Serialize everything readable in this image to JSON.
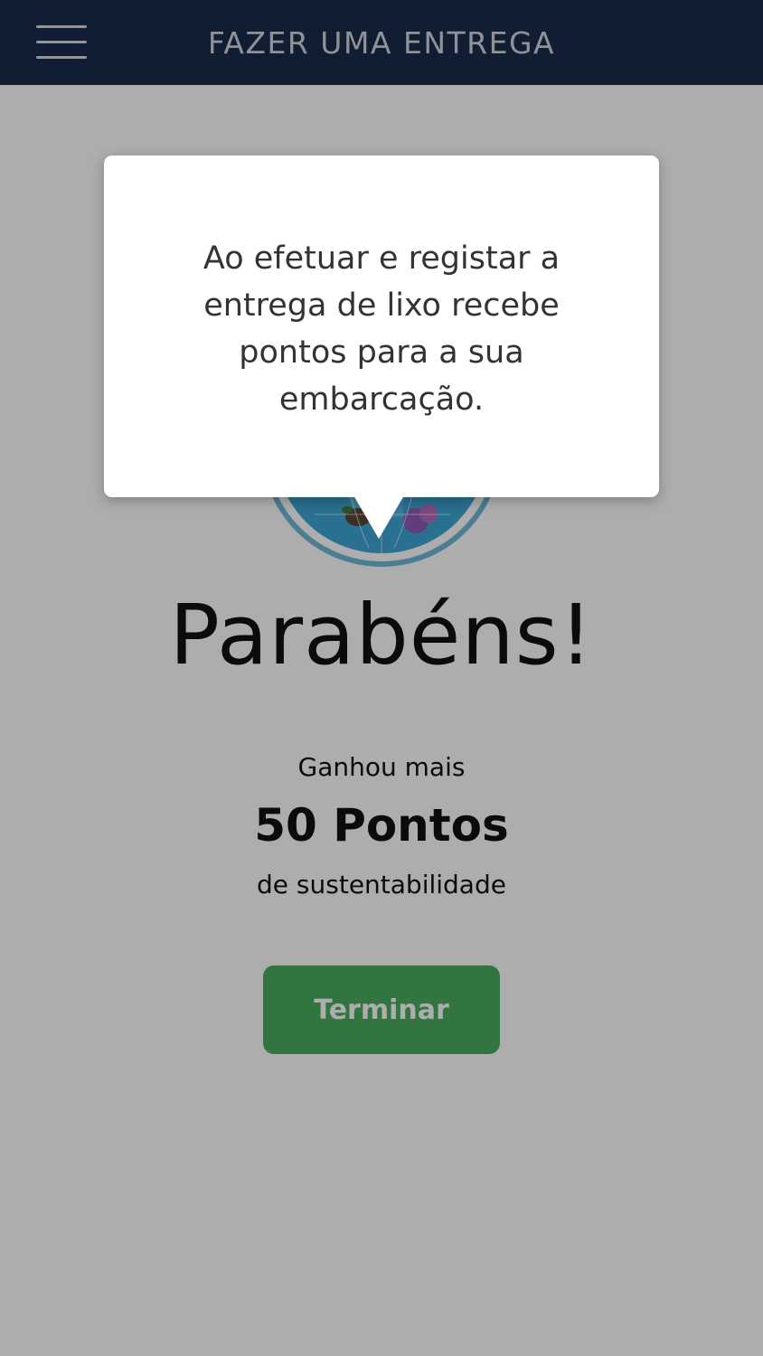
{
  "header": {
    "title": "FAZER UMA ENTREGA",
    "menu_icon": "hamburger-menu-icon"
  },
  "tooltip": {
    "text": "Ao efetuar e registar a entrega de lixo recebe pontos para a sua embarcação."
  },
  "main": {
    "logo_icon": "ocean-globe-logo",
    "congrats": "Parabéns!",
    "gain_label": "Ganhou mais",
    "points": "50 Pontos",
    "points_desc": "de sustentabilidade",
    "finish_label": "Terminar"
  },
  "colors": {
    "header_bg": "#192b4c",
    "button_green": "#4aad61",
    "overlay": "rgba(0,0,0,0.32)"
  }
}
